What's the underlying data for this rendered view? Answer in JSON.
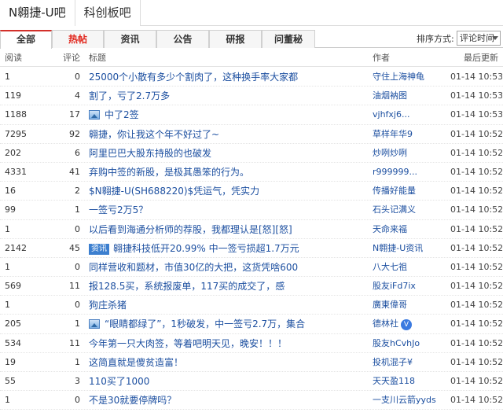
{
  "bar_tabs": [
    "N翱捷-U吧",
    "科创板吧"
  ],
  "sub_tabs": [
    {
      "label": "全部",
      "active": true,
      "hot": false
    },
    {
      "label": "热帖",
      "active": false,
      "hot": true
    },
    {
      "label": "资讯",
      "active": false,
      "hot": false
    },
    {
      "label": "公告",
      "active": false,
      "hot": false
    },
    {
      "label": "研报",
      "active": false,
      "hot": false
    },
    {
      "label": "问董秘",
      "active": false,
      "hot": false
    }
  ],
  "sort": {
    "label": "排序方式:",
    "value": "评论时间"
  },
  "columns": {
    "read": "阅读",
    "comments": "评论",
    "title": "标题",
    "author": "作者",
    "time": "最后更新"
  },
  "posts": [
    {
      "read": "1",
      "comments": "0",
      "title": "25000个小散有多少个割肉了，这种换手率大家都",
      "author": "守住上海神龟",
      "time": "01-14 10:53"
    },
    {
      "read": "119",
      "comments": "4",
      "title": "割了，亏了2.7万多",
      "author": "油烟衲图",
      "time": "01-14 10:53"
    },
    {
      "read": "1188",
      "comments": "17",
      "title": "中了2签",
      "author": "vjhfxj6...",
      "time": "01-14 10:53",
      "icon": "picture"
    },
    {
      "read": "7295",
      "comments": "92",
      "title": "翱捷，你让我这个年不好过了~",
      "author": "草样年华9",
      "time": "01-14 10:52"
    },
    {
      "read": "202",
      "comments": "6",
      "title": "阿里巴巴大股东持股的也破发",
      "author": "炒咧炒咧",
      "time": "01-14 10:52"
    },
    {
      "read": "4331",
      "comments": "41",
      "title": "弃购中签的新股，是极其愚笨的行为。",
      "author": "r999999...",
      "time": "01-14 10:52"
    },
    {
      "read": "16",
      "comments": "2",
      "title": "$N翱捷-U(SH688220)$凭运气，凭实力",
      "author": "传播好能量",
      "time": "01-14 10:52"
    },
    {
      "read": "99",
      "comments": "1",
      "title": "一签亏2万5？",
      "author": "石头记满义",
      "time": "01-14 10:52"
    },
    {
      "read": "1",
      "comments": "0",
      "title": "以后看到海通分析师的荐股，我都理认是[怒][怒]",
      "author": "天命来福",
      "time": "01-14 10:52"
    },
    {
      "read": "2142",
      "comments": "45",
      "title": "翱捷科技低开20.99% 中一签亏损超1.7万元",
      "author": "N翱捷-U资讯",
      "time": "01-14 10:52",
      "tag": "资讯"
    },
    {
      "read": "1",
      "comments": "0",
      "title": "同样营收和题材，市值30亿的大把，这货凭啥600",
      "author": "八大七祖",
      "time": "01-14 10:52"
    },
    {
      "read": "569",
      "comments": "11",
      "title": "报128.5买，系统报废单，117买的成交了，感",
      "author": "股友iFd7ix",
      "time": "01-14 10:52"
    },
    {
      "read": "1",
      "comments": "0",
      "title": "狗庄杀猪",
      "author": "廣東偉哥",
      "time": "01-14 10:52"
    },
    {
      "read": "205",
      "comments": "1",
      "title": "“眼睛都绿了”，1秒破发，中一签亏2.7万，集合",
      "author": "德林社",
      "time": "01-14 10:52",
      "icon": "picture",
      "verified": "V"
    },
    {
      "read": "534",
      "comments": "11",
      "title": "今年第一只大肉签，等着吧明天见，晚安！！！",
      "author": "股友hCvhJo",
      "time": "01-14 10:52"
    },
    {
      "read": "19",
      "comments": "1",
      "title": "这简直就是傻贫造富！",
      "author": "投机混子¥",
      "time": "01-14 10:52"
    },
    {
      "read": "55",
      "comments": "3",
      "title": "110买了1000",
      "author": "天天盈118",
      "time": "01-14 10:52"
    },
    {
      "read": "1",
      "comments": "0",
      "title": "不是30就要停牌吗？",
      "author": "一支川云箭yyds",
      "time": "01-14 10:52"
    }
  ]
}
